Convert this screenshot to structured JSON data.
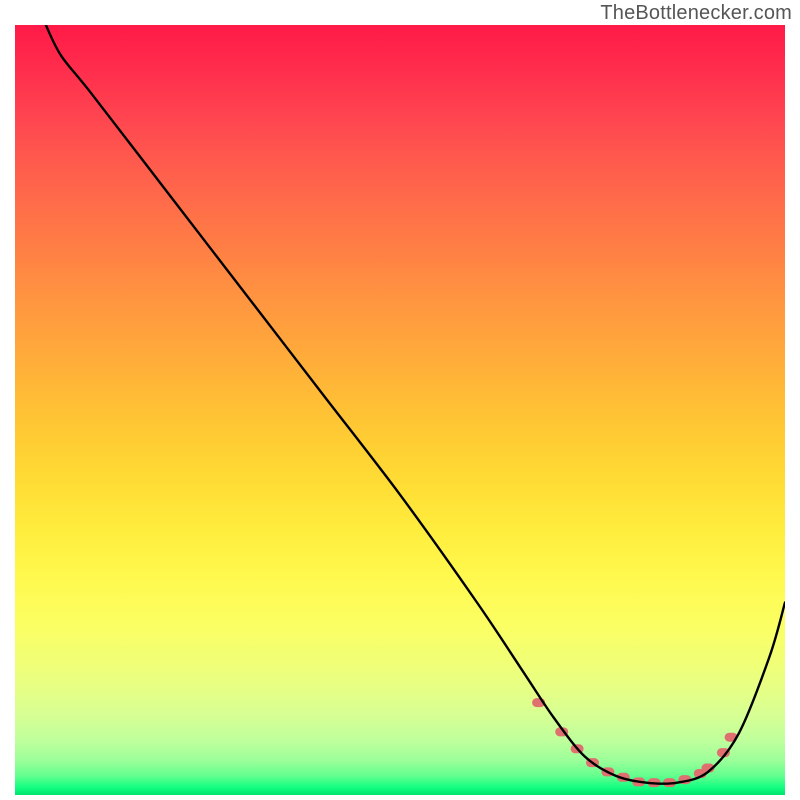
{
  "watermark": "TheBottlenecker.com",
  "chart_data": {
    "type": "line",
    "title": "",
    "xlabel": "",
    "ylabel": "",
    "xlim": [
      0,
      100
    ],
    "ylim": [
      0,
      100
    ],
    "axes_visible": false,
    "grid": false,
    "background_gradient": {
      "direction": "vertical",
      "stops": [
        {
          "pos": 0.0,
          "color": "#ff1a47"
        },
        {
          "pos": 0.5,
          "color": "#ffcd33"
        },
        {
          "pos": 0.78,
          "color": "#fbff63"
        },
        {
          "pos": 0.97,
          "color": "#63ff8e"
        },
        {
          "pos": 1.0,
          "color": "#00e36e"
        }
      ]
    },
    "series": [
      {
        "name": "bottleneck-curve",
        "color": "#000000",
        "x": [
          4,
          6,
          10,
          20,
          30,
          40,
          50,
          60,
          66,
          70,
          74,
          78,
          82,
          86,
          90,
          94,
          98,
          100
        ],
        "y": [
          100,
          96,
          91,
          78,
          65,
          52,
          39,
          25,
          16,
          10,
          5,
          2.5,
          1.6,
          1.6,
          3,
          8,
          18,
          25
        ]
      }
    ],
    "markers": {
      "name": "optimal-range-dots",
      "color": "#e07070",
      "shape": "rounded-rect",
      "x": [
        68,
        71,
        73,
        75,
        77,
        79,
        81,
        83,
        85,
        87,
        89,
        90,
        92,
        93
      ],
      "y": [
        12,
        8.2,
        6,
        4.2,
        3,
        2.3,
        1.7,
        1.6,
        1.6,
        2,
        2.8,
        3.5,
        5.5,
        7.5
      ]
    }
  }
}
